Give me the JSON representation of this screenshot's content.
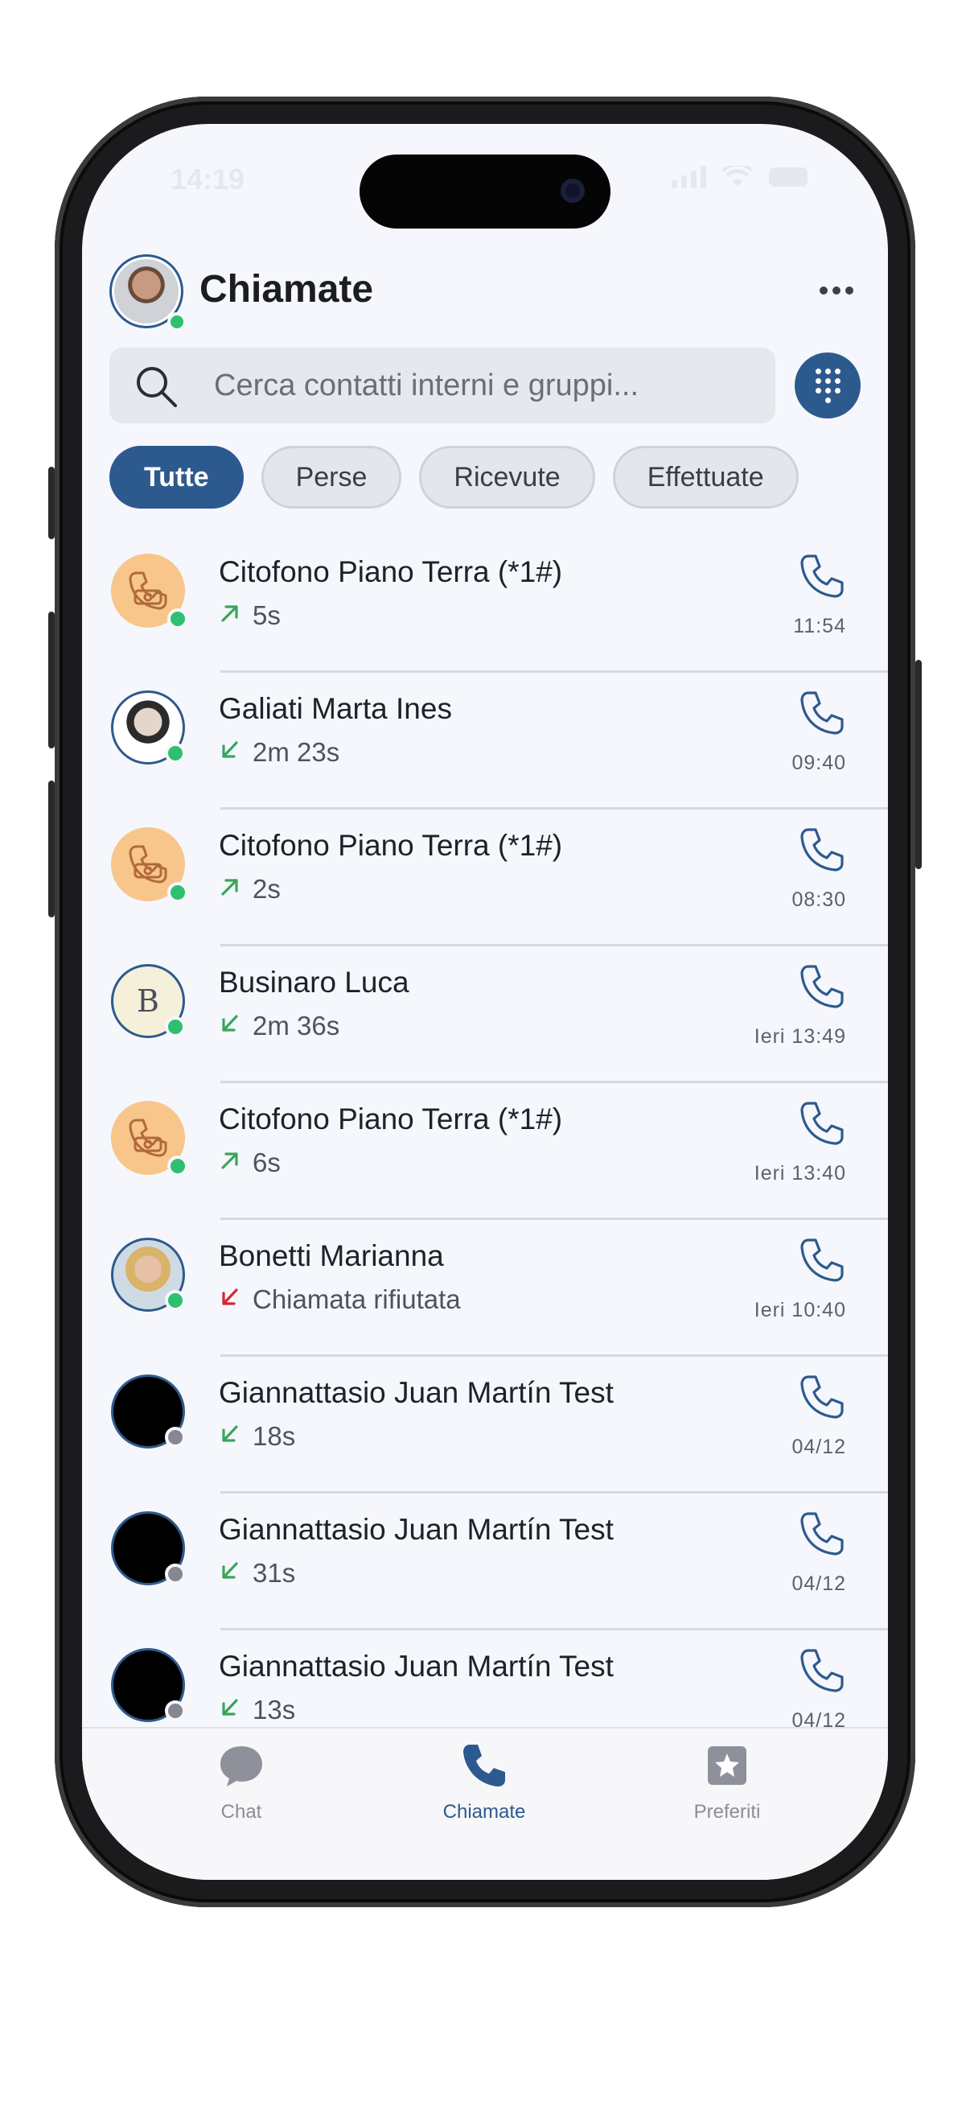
{
  "status_bar": {
    "time": "14:19"
  },
  "header": {
    "title": "Chiamate",
    "more_label": "Altro"
  },
  "search": {
    "placeholder": "Cerca contatti interni e gruppi..."
  },
  "filters": [
    {
      "label": "Tutte",
      "active": true
    },
    {
      "label": "Perse",
      "active": false
    },
    {
      "label": "Ricevute",
      "active": false
    },
    {
      "label": "Effettuate",
      "active": false
    }
  ],
  "calls": [
    {
      "name": "Citofono Piano Terra (*1#)",
      "detail": "5s",
      "direction": "outgoing",
      "time": "11:54",
      "avatar": "intercom"
    },
    {
      "name": "Galiati Marta Ines",
      "detail": "2m 23s",
      "direction": "incoming",
      "time": "09:40",
      "avatar": "photo-f"
    },
    {
      "name": "Citofono Piano Terra (*1#)",
      "detail": "2s",
      "direction": "outgoing",
      "time": "08:30",
      "avatar": "intercom"
    },
    {
      "name": "Businaro Luca",
      "detail": "2m 36s",
      "direction": "incoming",
      "time": "Ieri 13:49",
      "avatar": "letter",
      "initial": "B"
    },
    {
      "name": "Citofono Piano Terra (*1#)",
      "detail": "6s",
      "direction": "outgoing",
      "time": "Ieri 13:40",
      "avatar": "intercom"
    },
    {
      "name": "Bonetti Marianna",
      "detail": "Chiamata rifiutata",
      "direction": "rejected",
      "time": "Ieri 10:40",
      "avatar": "photo-b"
    },
    {
      "name": "Giannattasio Juan Martín Test",
      "detail": "18s",
      "direction": "incoming",
      "time": "04/12",
      "avatar": "dark"
    },
    {
      "name": "Giannattasio Juan Martín Test",
      "detail": "31s",
      "direction": "incoming",
      "time": "04/12",
      "avatar": "dark"
    },
    {
      "name": "Giannattasio Juan Martín Test",
      "detail": "13s",
      "direction": "incoming",
      "time": "04/12",
      "avatar": "dark"
    }
  ],
  "tabbar": {
    "chat": "Chat",
    "calls": "Chiamate",
    "favorites": "Preferiti"
  },
  "colors": {
    "accent": "#2d5a8e",
    "outgoing_arrow": "#3aa55a",
    "incoming_arrow": "#3aa55a",
    "rejected_arrow": "#d8262f",
    "online": "#2fbf71",
    "offline": "#858891"
  }
}
